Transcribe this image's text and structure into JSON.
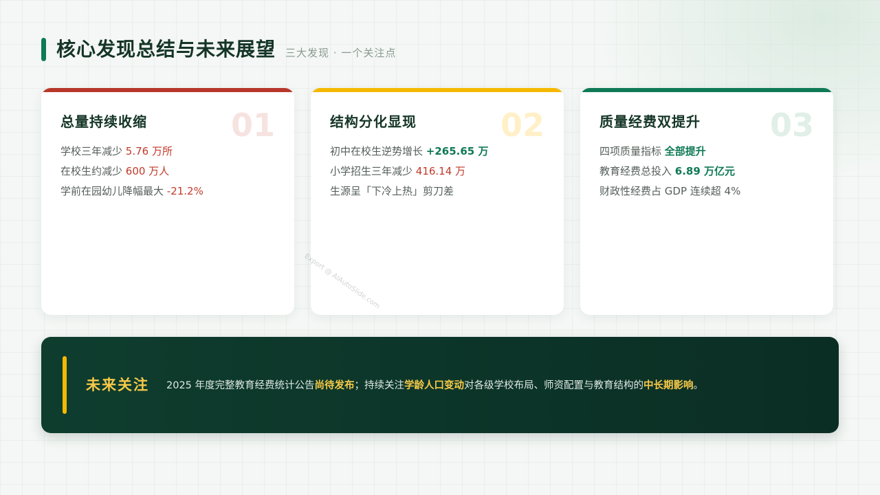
{
  "header": {
    "title": "核心发现总结与未来展望",
    "subtitle": "三大发现 · 一个关注点"
  },
  "cards": [
    {
      "title": "总量持续收缩",
      "number": "01",
      "accent": "#b8372a",
      "number_color": "#f6e3e0",
      "lines": [
        {
          "text": "学校三年减少 ",
          "value": "5.76 万所"
        },
        {
          "text": "在校生约减少 ",
          "value": "600 万人"
        },
        {
          "text": "学前在园幼儿降幅最大 ",
          "value": "-21.2%"
        }
      ]
    },
    {
      "title": "结构分化显现",
      "number": "02",
      "accent": "#f5b800",
      "number_color": "#fff0c8",
      "lines": [
        {
          "text": "初中在校生逆势增长 ",
          "value": "+265.65 万"
        },
        {
          "text": "小学招生三年减少 ",
          "value": "416.14 万"
        },
        {
          "text": "生源呈「下冷上热」剪刀差",
          "value": ""
        }
      ]
    },
    {
      "title": "质量经费双提升",
      "number": "03",
      "accent": "#0f7a55",
      "number_color": "#e0efe8",
      "lines": [
        {
          "text": "四项质量指标 ",
          "value": "全部提升"
        },
        {
          "text": "教育经费总投入 ",
          "value": "6.89 万亿元"
        },
        {
          "text": "财政性经费占 GDP 连续超 4%",
          "value": ""
        }
      ]
    }
  ],
  "watermark": "Export @ AIAutoSlide.com",
  "banner": {
    "label": "未来关注",
    "segments": [
      "2025 年度完整教育经费统计公告",
      "尚待发布",
      "；持续关注",
      "学龄人口变动",
      "对各级学校布局、师资配置与教育结构的",
      "中长期影响",
      "。"
    ]
  },
  "colors": {
    "brand_green": "#0f7a55",
    "accent_red": "#c03a2b",
    "accent_yellow": "#f7c948",
    "banner_bg": "#0e3d2e"
  }
}
